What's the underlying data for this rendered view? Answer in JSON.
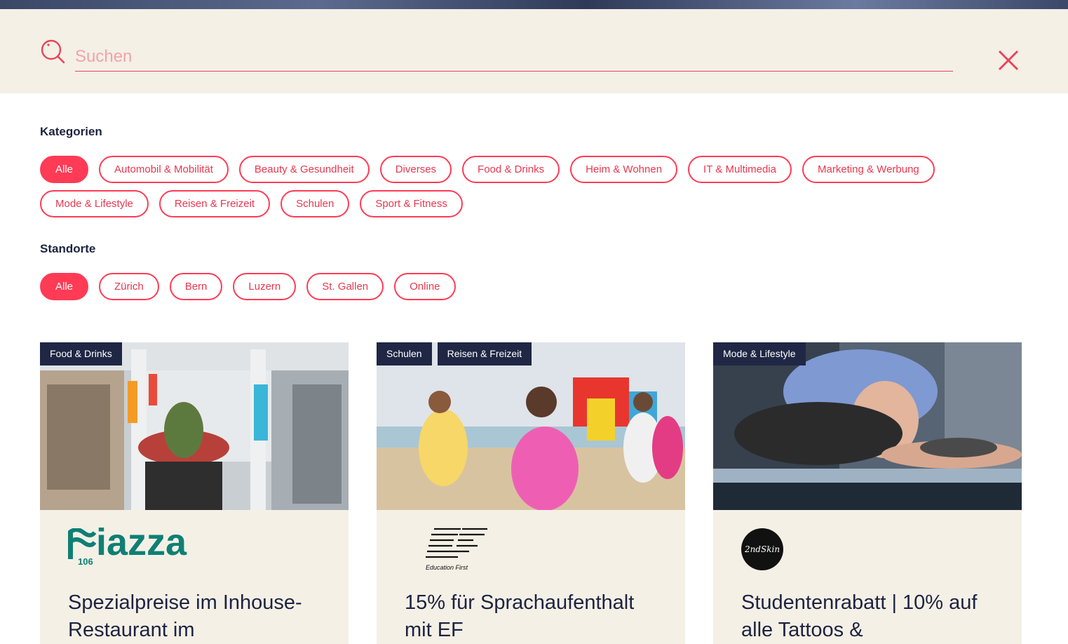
{
  "search": {
    "placeholder": "Suchen",
    "value": ""
  },
  "categories": {
    "title": "Kategorien",
    "items": [
      "Alle",
      "Automobil & Mobilität",
      "Beauty & Gesundheit",
      "Diverses",
      "Food & Drinks",
      "Heim & Wohnen",
      "IT & Multimedia",
      "Marketing & Werbung",
      "Mode & Lifestyle",
      "Reisen & Freizeit",
      "Schulen",
      "Sport & Fitness"
    ],
    "active": "Alle"
  },
  "locations": {
    "title": "Standorte",
    "items": [
      "Alle",
      "Zürich",
      "Bern",
      "Luzern",
      "St. Gallen",
      "Online"
    ],
    "active": "Alle"
  },
  "cards": [
    {
      "tags": [
        "Food & Drinks"
      ],
      "logo_text": "iazza",
      "logo_sub": "106",
      "title": "Spezialpreise im Inhouse-Restaurant im"
    },
    {
      "tags": [
        "Schulen",
        "Reisen & Freizeit"
      ],
      "logo_text": "EF",
      "logo_sub": "Education First",
      "title": "15% für Sprachaufenthalt mit EF"
    },
    {
      "tags": [
        "Mode & Lifestyle"
      ],
      "logo_text": "2ndSkin",
      "logo_sub": "",
      "title": "Studentenrabatt | 10% auf alle Tattoos &"
    }
  ],
  "colors": {
    "accent": "#ff3b55",
    "navy": "#1f2745",
    "cream": "#f4f0e6",
    "teal": "#0f7f74"
  }
}
